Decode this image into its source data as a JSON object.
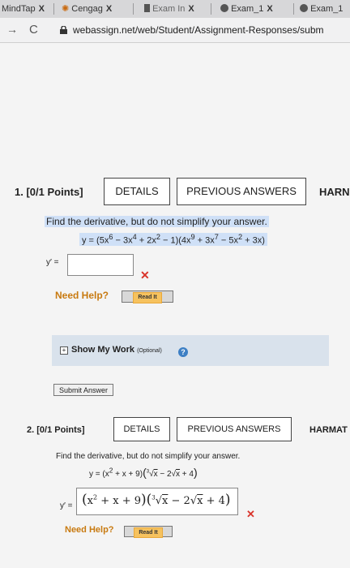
{
  "tabs": [
    {
      "label": "MindTap",
      "close": "X"
    },
    {
      "label": "Cengag",
      "close": "X"
    },
    {
      "label": "Exam In",
      "close": "X"
    },
    {
      "label": "Exam_1",
      "close": "X"
    },
    {
      "label": "Exam_1"
    }
  ],
  "address": {
    "url": "webassign.net/web/Student/Assignment-Responses/subm"
  },
  "q1": {
    "number": "1.  [0/1 Points]",
    "details": "DETAILS",
    "previous": "PREVIOUS ANSWERS",
    "truncated": "HARN",
    "prompt": "Find the derivative, but do not simplify your answer.",
    "answer_label": "y′ =",
    "need_help": "Need Help?",
    "read_it": "Read It",
    "show_work": "Show My Work",
    "optional": "(Optional)",
    "submit": "Submit Answer"
  },
  "q2": {
    "number": "2.  [0/1 Points]",
    "details": "DETAILS",
    "previous": "PREVIOUS ANSWERS",
    "truncated": "HARMAT",
    "prompt": "Find the derivative, but do not simplify your answer.",
    "answer_label": "y′ =",
    "need_help": "Need Help?",
    "read_it": "Read It"
  },
  "colors": {
    "error": "#d9342b",
    "help": "#c87a10",
    "highlight": "#cfe0f7",
    "readit": "#f6c25e"
  }
}
